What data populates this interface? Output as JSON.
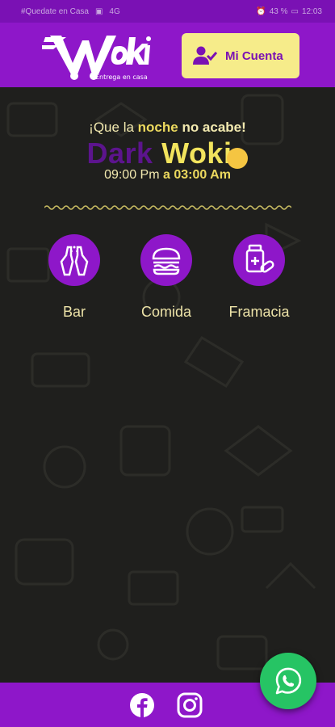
{
  "status_bar": {
    "carrier": "#Quedate en Casa",
    "extra": "4G",
    "battery": "43 %",
    "time": "12:03"
  },
  "header": {
    "logo_text": "Woki",
    "logo_slogan": "Entrega en casa",
    "account_label": "Mi Cuenta"
  },
  "promo": {
    "tagline_start": "¡Que la ",
    "tagline_noche": "noche",
    "tagline_end": " no acabe!",
    "title_dark": "Dark",
    "title_woki": "Woki",
    "hours_start": "09:00 Pm",
    "hours_a": "a",
    "hours_end": "03:00 Am"
  },
  "categories": [
    {
      "label": "Bar",
      "icon": "beer-bottles-icon"
    },
    {
      "label": "Comida",
      "icon": "burger-icon"
    },
    {
      "label": "Framacia",
      "icon": "medicine-icon"
    }
  ],
  "footer": {
    "social": [
      "facebook-icon",
      "instagram-icon"
    ],
    "fab_icon": "whatsapp-icon"
  },
  "colors": {
    "primary": "#8e17c9",
    "accent_yellow": "#f6ec8a",
    "background": "#1f1f1d",
    "whatsapp": "#26c464"
  }
}
